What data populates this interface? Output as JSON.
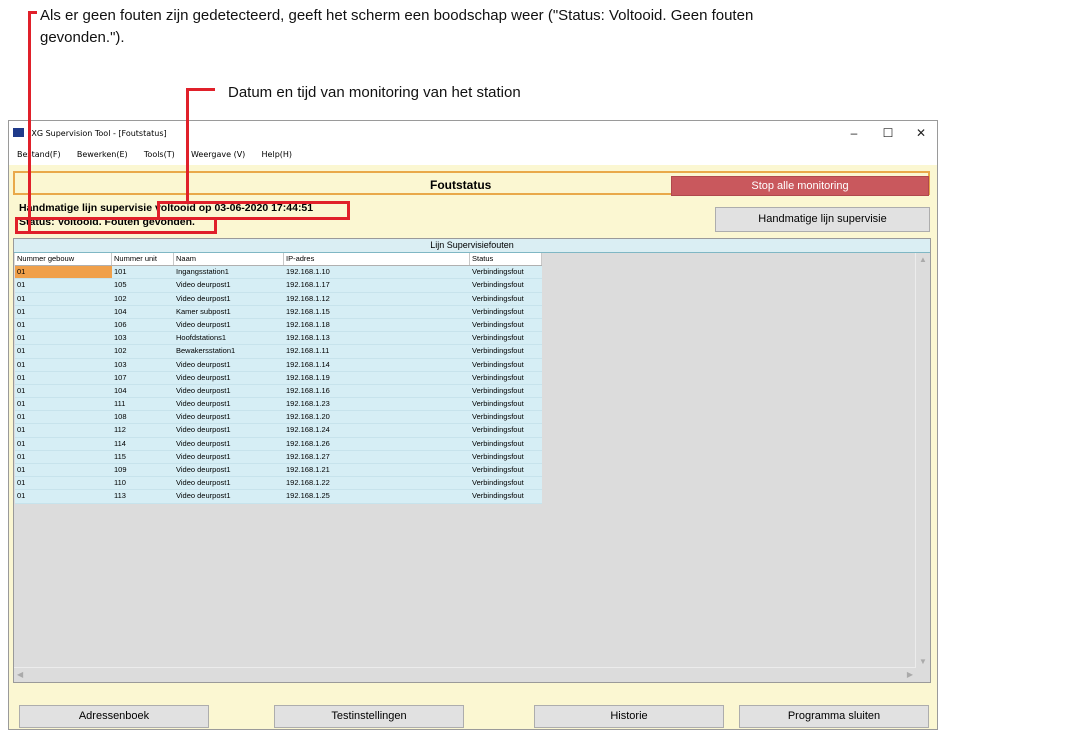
{
  "annotations": {
    "no_errors_line1": "Als er geen fouten zijn gedetecteerd, geeft het scherm een boodschap weer (\"Status: Voltooid. Geen fouten",
    "no_errors_line2": "gevonden.\").",
    "datetime_note": "Datum en tijd van monitoring van het station"
  },
  "window": {
    "title": "IXG Supervision Tool - [Foutstatus]",
    "controls": {
      "minimize": "–",
      "maximize": "☐",
      "close": "✕"
    }
  },
  "menu": [
    "Bestand(F)",
    "Bewerken(E)",
    "Tools(T)",
    "Weergave (V)",
    "Help(H)"
  ],
  "header": {
    "title": "Foutstatus",
    "stop_button": "Stop alle monitoring"
  },
  "info": {
    "supervision_prefix": "Handmatige lijn supervisie",
    "completed_text": "voltooid op 03-06-2020 17:44:51",
    "status_text": "Status: Voltooid. Fouten gevonden.",
    "manual_button": "Handmatige lijn supervisie"
  },
  "table": {
    "title": "Lijn Supervisiefouten",
    "columns": [
      "Nummer gebouw",
      "Nummer unit",
      "Naam",
      "IP-adres",
      "Status"
    ],
    "rows": [
      [
        "01",
        "101",
        "Ingangsstation1",
        "192.168.1.10",
        "Verbindingsfout"
      ],
      [
        "01",
        "105",
        "Video deurpost1",
        "192.168.1.17",
        "Verbindingsfout"
      ],
      [
        "01",
        "102",
        "Video deurpost1",
        "192.168.1.12",
        "Verbindingsfout"
      ],
      [
        "01",
        "104",
        "Kamer subpost1",
        "192.168.1.15",
        "Verbindingsfout"
      ],
      [
        "01",
        "106",
        "Video deurpost1",
        "192.168.1.18",
        "Verbindingsfout"
      ],
      [
        "01",
        "103",
        "Hoofdstations1",
        "192.168.1.13",
        "Verbindingsfout"
      ],
      [
        "01",
        "102",
        "Bewakersstation1",
        "192.168.1.11",
        "Verbindingsfout"
      ],
      [
        "01",
        "103",
        "Video deurpost1",
        "192.168.1.14",
        "Verbindingsfout"
      ],
      [
        "01",
        "107",
        "Video deurpost1",
        "192.168.1.19",
        "Verbindingsfout"
      ],
      [
        "01",
        "104",
        "Video deurpost1",
        "192.168.1.16",
        "Verbindingsfout"
      ],
      [
        "01",
        "111",
        "Video deurpost1",
        "192.168.1.23",
        "Verbindingsfout"
      ],
      [
        "01",
        "108",
        "Video deurpost1",
        "192.168.1.20",
        "Verbindingsfout"
      ],
      [
        "01",
        "112",
        "Video deurpost1",
        "192.168.1.24",
        "Verbindingsfout"
      ],
      [
        "01",
        "114",
        "Video deurpost1",
        "192.168.1.26",
        "Verbindingsfout"
      ],
      [
        "01",
        "115",
        "Video deurpost1",
        "192.168.1.27",
        "Verbindingsfout"
      ],
      [
        "01",
        "109",
        "Video deurpost1",
        "192.168.1.21",
        "Verbindingsfout"
      ],
      [
        "01",
        "110",
        "Video deurpost1",
        "192.168.1.22",
        "Verbindingsfout"
      ],
      [
        "01",
        "113",
        "Video deurpost1",
        "192.168.1.25",
        "Verbindingsfout"
      ]
    ]
  },
  "buttons": {
    "address_book": "Adressenboek",
    "test_settings": "Testinstellingen",
    "history": "Historie",
    "close_program": "Programma sluiten"
  },
  "colors": {
    "highlight": "#e0202a",
    "stop_button": "#c9585d",
    "background": "#fbf7d2",
    "grid_row": "#d6eef5"
  }
}
